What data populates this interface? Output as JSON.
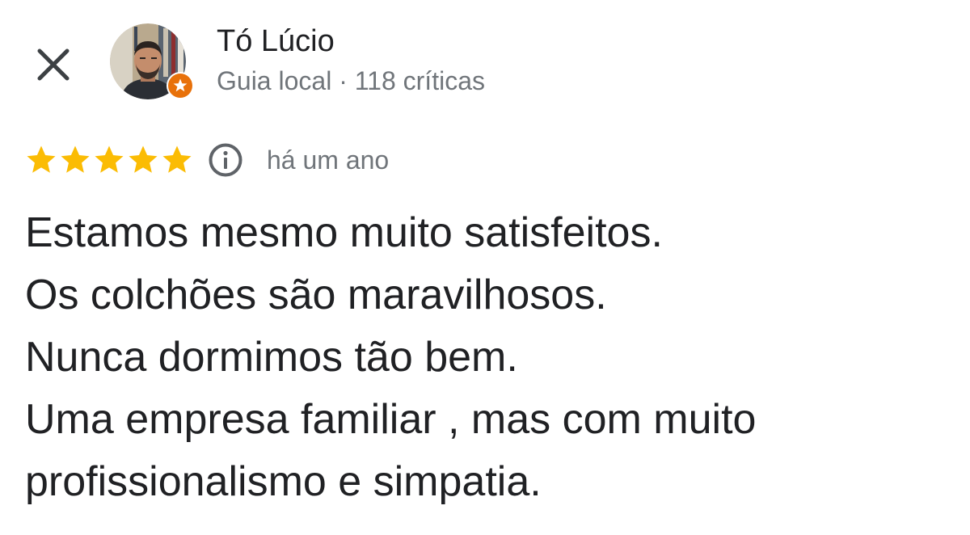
{
  "header": {
    "close_icon": "close-icon",
    "author": {
      "name": "Tó Lúcio",
      "meta": "Guia local · 118 críticas",
      "badge_icon": "local-guide-star-icon"
    }
  },
  "review": {
    "rating": 5,
    "rating_max": 5,
    "star_color": "#fbbc04",
    "info_icon": "info-icon",
    "date": "há um ano",
    "lines": [
      "Estamos mesmo muito satisfeitos.",
      "Os colchões são maravilhosos.",
      "Nunca dormimos tão bem.",
      "Uma empresa familiar , mas com muito",
      "profissionalismo e simpatia."
    ]
  },
  "colors": {
    "text_primary": "#202124",
    "text_secondary": "#70757a",
    "guide_badge": "#e8710a"
  }
}
